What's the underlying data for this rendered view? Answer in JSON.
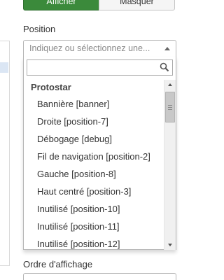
{
  "toggle": {
    "show_label": "Afficher",
    "hide_label": "Masquer"
  },
  "position_field": {
    "label": "Position",
    "placeholder": "Indiquez ou sélectionnez une...",
    "search_value": "",
    "group": "Protostar",
    "options": [
      "Bannière [banner]",
      "Droite [position-7]",
      "Débogage [debug]",
      "Fil de navigation [position-2]",
      "Gauche [position-8]",
      "Haut centré [position-3]",
      "Inutilisé [position-10]",
      "Inutilisé [position-11]",
      "Inutilisé [position-12]"
    ]
  },
  "order_field": {
    "label": "Ordre d'affichage"
  },
  "colors": {
    "accent_green": "#3b8a3b",
    "selected_row": "#dbe6f4"
  },
  "icons": {
    "search": "search-icon",
    "caret": "caret-up-icon",
    "scroll_up": "scroll-up-icon",
    "scroll_down": "scroll-down-icon"
  }
}
